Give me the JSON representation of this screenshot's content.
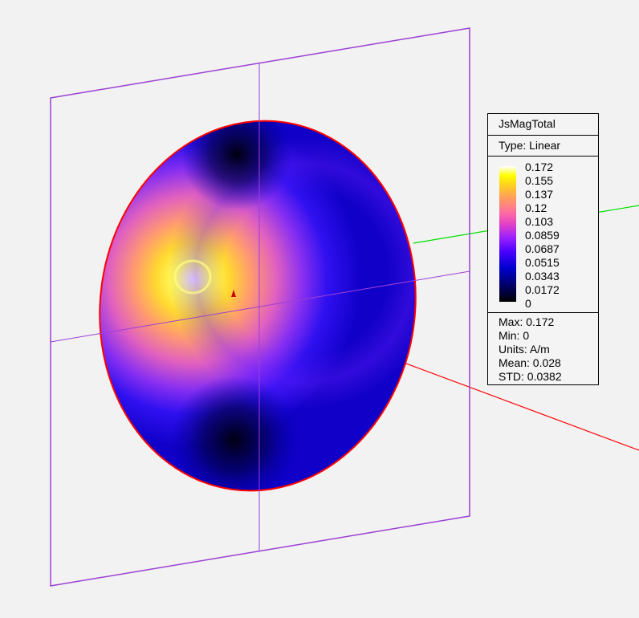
{
  "legend": {
    "title": "JsMagTotal",
    "type": "Type: Linear",
    "ticks": [
      "0.172",
      "0.155",
      "0.137",
      "0.12",
      "0.103",
      "0.0859",
      "0.0687",
      "0.0515",
      "0.0343",
      "0.0172",
      "0"
    ],
    "stats": {
      "max": "Max: 0.172",
      "min": "Min: 0",
      "units": "Units: A/m",
      "mean": "Mean: 0.028",
      "std": "STD: 0.0382"
    }
  },
  "colors": {
    "background": "#f2f2f2",
    "plane": "#9b3fd6",
    "axis_x": "#ff0000",
    "axis_y": "#00e000",
    "edge": "#ff0000"
  }
}
